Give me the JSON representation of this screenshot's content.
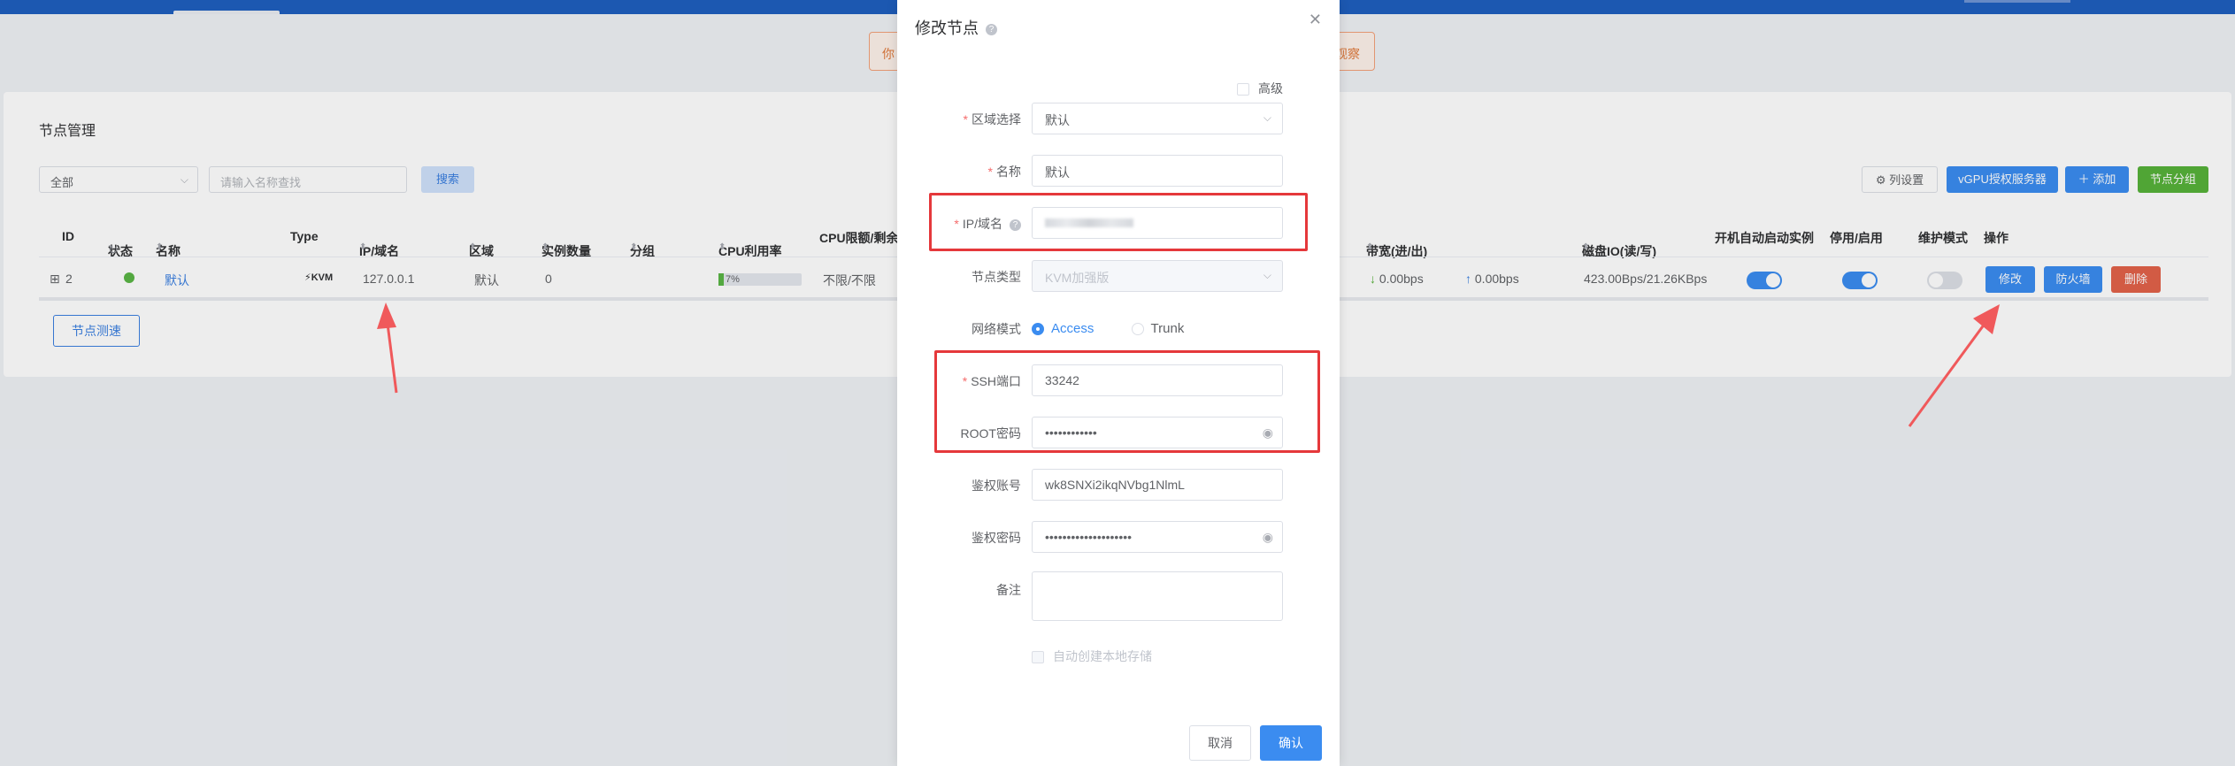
{
  "notice": {
    "left": "你",
    "right": "观察"
  },
  "page": {
    "card_title": "节点管理",
    "filter": {
      "value": "全部",
      "search_placeholder": "请输入名称查找",
      "search_btn": "搜索"
    },
    "toolbar": {
      "columns": "列设置",
      "vgpu": "vGPU授权服务器",
      "add": "添加",
      "group": "节点分组"
    },
    "table": {
      "headers": {
        "id": "ID",
        "status": "状态",
        "name": "名称",
        "type": "Type",
        "ip": "IP/域名",
        "region": "区域",
        "instances": "实例数量",
        "group": "分组",
        "cpu": "CPU利用率",
        "cpu_limit": "CPU限额/剩余",
        "bandwidth": "带宽(进/出)",
        "disk": "磁盘IO(读/写)",
        "autostart": "开机自动启动实例",
        "enable": "停用/启用",
        "maintain": "维护模式",
        "ops": "操作"
      },
      "row": {
        "id": "2",
        "name": "默认",
        "type": "KVM",
        "ip": "127.0.0.1",
        "region": "默认",
        "instances": "0",
        "cpu": "7%",
        "cpu_limit": "不限/不限",
        "bw_in": "0.00bps",
        "bw_out": "0.00bps",
        "disk": "423.00Bps/21.26KBps",
        "autostart": true,
        "enabled": true,
        "maintenance": false,
        "btn_edit": "修改",
        "btn_firewall": "防火墙",
        "btn_delete": "删除"
      }
    },
    "speedtest": "节点测速"
  },
  "modal": {
    "title": "修改节点",
    "advanced": "高级",
    "fields": {
      "region": {
        "label": "区域选择",
        "value": "默认"
      },
      "name": {
        "label": "名称",
        "value": "默认"
      },
      "ip": {
        "label": "IP/域名"
      },
      "node_type": {
        "label": "节点类型",
        "value": "KVM加强版"
      },
      "network_mode": {
        "label": "网络模式",
        "options": [
          "Access",
          "Trunk"
        ],
        "selected": "Access"
      },
      "ssh_port": {
        "label": "SSH端口",
        "value": "33242"
      },
      "root_pwd": {
        "label": "ROOT密码",
        "value": "••••••••••••"
      },
      "auth_account": {
        "label": "鉴权账号",
        "value": "wk8SNXi2ikqNVbg1NlmL"
      },
      "auth_pwd": {
        "label": "鉴权密码",
        "value": "••••••••••••••••••••"
      },
      "remark": {
        "label": "备注"
      }
    },
    "auto_storage": "自动创建本地存储",
    "cancel": "取消",
    "confirm": "确认"
  },
  "colors": {
    "primary": "#3b8cf0",
    "success": "#57b23a",
    "danger": "#e2624a",
    "highlight": "#e5383b"
  }
}
